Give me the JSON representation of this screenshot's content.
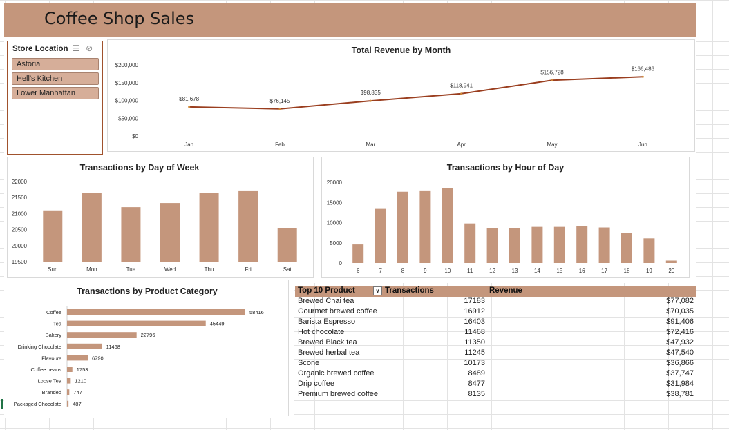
{
  "header": {
    "title": "Coffee Shop Sales"
  },
  "slicer": {
    "title": "Store Location",
    "items": [
      {
        "label": "Astoria"
      },
      {
        "label": "Hell's Kitchen"
      },
      {
        "label": "Lower Manhattan"
      }
    ]
  },
  "revenue_chart": {
    "title": "Total Revenue by Month",
    "color": "#9a3e1f",
    "y_ticks": [
      "$200,000",
      "$150,000",
      "$100,000",
      "$50,000",
      "$0"
    ],
    "months": [
      "Jan",
      "Feb",
      "Mar",
      "Apr",
      "May",
      "Jun"
    ],
    "values": [
      81678,
      76145,
      98835,
      118941,
      156728,
      166486
    ],
    "labels": [
      "$81,678",
      "$76,145",
      "$98,835",
      "$118,941",
      "$156,728",
      "$166,486"
    ]
  },
  "day_chart": {
    "title": "Transactions by Day of Week",
    "color": "#c4967c",
    "y_ticks": [
      "22000",
      "21500",
      "21000",
      "20500",
      "20000",
      "19500"
    ],
    "days": [
      "Sun",
      "Mon",
      "Tue",
      "Wed",
      "Thu",
      "Fri",
      "Sat"
    ],
    "values": [
      21100,
      21640,
      21200,
      21330,
      21650,
      21700,
      20550
    ]
  },
  "hour_chart": {
    "title": "Transactions by Hour of Day",
    "color": "#c4967c",
    "y_ticks": [
      "20000",
      "15000",
      "10000",
      "5000",
      "0"
    ],
    "hours": [
      "6",
      "7",
      "8",
      "9",
      "10",
      "11",
      "12",
      "13",
      "14",
      "15",
      "16",
      "17",
      "18",
      "19",
      "20"
    ],
    "values": [
      4600,
      13400,
      17650,
      17800,
      18500,
      9800,
      8700,
      8650,
      8950,
      8950,
      9100,
      8800,
      7400,
      6100,
      600
    ]
  },
  "category_chart": {
    "title": "Transactions by Product Category",
    "color": "#c4967c",
    "categories": [
      "Coffee",
      "Tea",
      "Bakery",
      "Drinking Chocolate",
      "Flavours",
      "Coffee beans",
      "Loose Tea",
      "Branded",
      "Packaged Chocolate"
    ],
    "values": [
      58416,
      45449,
      22796,
      11468,
      6790,
      1753,
      1210,
      747,
      487
    ],
    "labels": [
      "58416",
      "45449",
      "22796",
      "11468",
      "6790",
      "1753",
      "1210",
      "747",
      "487"
    ]
  },
  "top_table": {
    "headers": {
      "product": "Top 10 Product",
      "transactions": "Transactions",
      "revenue": "Revenue"
    },
    "rows": [
      {
        "product": "Brewed Chai tea",
        "transactions": "17183",
        "revenue": "$77,082"
      },
      {
        "product": "Gourmet brewed coffee",
        "transactions": "16912",
        "revenue": "$70,035"
      },
      {
        "product": "Barista Espresso",
        "transactions": "16403",
        "revenue": "$91,406"
      },
      {
        "product": "Hot chocolate",
        "transactions": "11468",
        "revenue": "$72,416"
      },
      {
        "product": "Brewed Black tea",
        "transactions": "11350",
        "revenue": "$47,932"
      },
      {
        "product": "Brewed herbal tea",
        "transactions": "11245",
        "revenue": "$47,540"
      },
      {
        "product": "Scone",
        "transactions": "10173",
        "revenue": "$36,866"
      },
      {
        "product": "Organic brewed coffee",
        "transactions": "8489",
        "revenue": "$37,747"
      },
      {
        "product": "Drip coffee",
        "transactions": "8477",
        "revenue": "$31,984"
      },
      {
        "product": "Premium brewed coffee",
        "transactions": "8135",
        "revenue": "$38,781"
      }
    ]
  },
  "chart_data": [
    {
      "type": "line",
      "title": "Total Revenue by Month",
      "categories": [
        "Jan",
        "Feb",
        "Mar",
        "Apr",
        "May",
        "Jun"
      ],
      "values": [
        81678,
        76145,
        98835,
        118941,
        156728,
        166486
      ],
      "ylim": [
        0,
        200000
      ]
    },
    {
      "type": "bar",
      "title": "Transactions by Day of Week",
      "categories": [
        "Sun",
        "Mon",
        "Tue",
        "Wed",
        "Thu",
        "Fri",
        "Sat"
      ],
      "values": [
        21100,
        21640,
        21200,
        21330,
        21650,
        21700,
        20550
      ],
      "ylim": [
        19500,
        22000
      ]
    },
    {
      "type": "bar",
      "title": "Transactions by Hour of Day",
      "categories": [
        "6",
        "7",
        "8",
        "9",
        "10",
        "11",
        "12",
        "13",
        "14",
        "15",
        "16",
        "17",
        "18",
        "19",
        "20"
      ],
      "values": [
        4600,
        13400,
        17650,
        17800,
        18500,
        9800,
        8700,
        8650,
        8950,
        8950,
        9100,
        8800,
        7400,
        6100,
        600
      ],
      "ylim": [
        0,
        20000
      ]
    },
    {
      "type": "bar",
      "title": "Transactions by Product Category",
      "categories": [
        "Coffee",
        "Tea",
        "Bakery",
        "Drinking Chocolate",
        "Flavours",
        "Coffee beans",
        "Loose Tea",
        "Branded",
        "Packaged Chocolate"
      ],
      "values": [
        58416,
        45449,
        22796,
        11468,
        6790,
        1753,
        1210,
        747,
        487
      ]
    }
  ]
}
